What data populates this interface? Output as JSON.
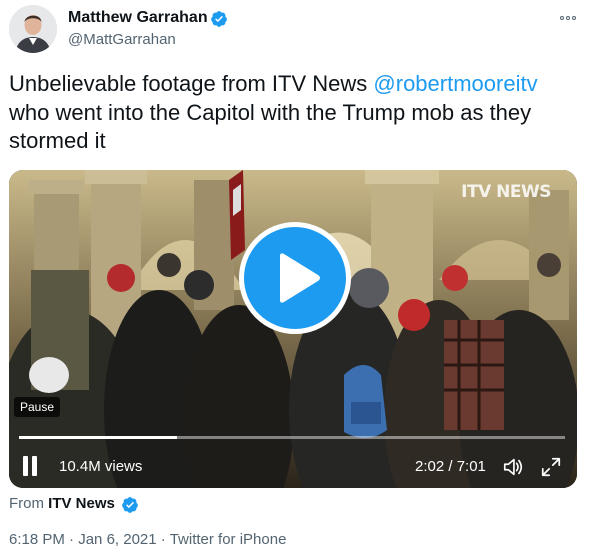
{
  "author": {
    "display_name": "Matthew Garrahan",
    "handle": "@MattGarrahan",
    "verified": true
  },
  "tweet": {
    "text_before": "Unbelievable footage from ITV News ",
    "mention": "@robertmooreitv",
    "text_after": " who went into the Capitol with the Trump mob as they stormed it"
  },
  "video": {
    "watermark": "ITV NEWS",
    "tooltip": "Pause",
    "views": "10.4M views",
    "timecode": "2:02 / 7:01",
    "progress": 0.29
  },
  "source": {
    "prefix": "From ",
    "name": "ITV News",
    "verified": true
  },
  "meta": {
    "time": "6:18 PM",
    "separator1": " · ",
    "date": "Jan 6, 2021",
    "separator2": " · ",
    "client": "Twitter for iPhone"
  },
  "colors": {
    "accent": "#1d9bf0",
    "text": "#0f1419",
    "muted": "#536471"
  },
  "icons": [
    "verified-badge-icon",
    "more-icon",
    "play-icon",
    "pause-icon",
    "volume-icon",
    "fullscreen-icon"
  ]
}
